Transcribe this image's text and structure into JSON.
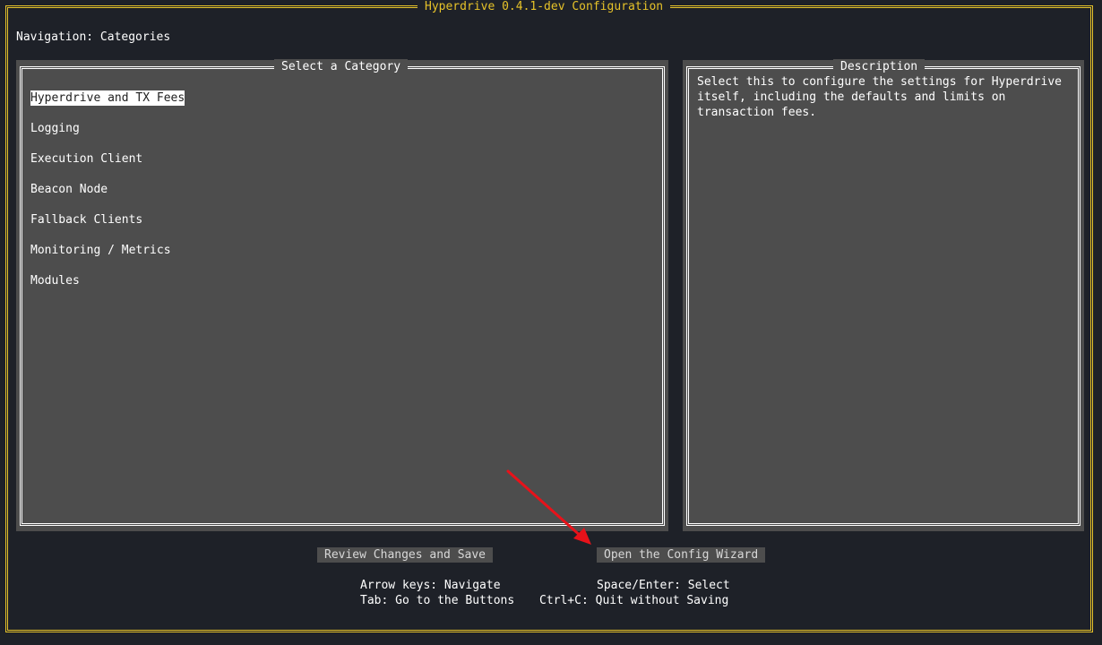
{
  "window": {
    "title": "Hyperdrive 0.4.1-dev Configuration"
  },
  "navigation": {
    "label": "Navigation: Categories"
  },
  "categories_panel": {
    "title": "Select a Category",
    "selected_index": 0,
    "items": [
      {
        "label": "Hyperdrive and TX Fees"
      },
      {
        "label": "Logging"
      },
      {
        "label": "Execution Client"
      },
      {
        "label": "Beacon Node"
      },
      {
        "label": "Fallback Clients"
      },
      {
        "label": "Monitoring / Metrics"
      },
      {
        "label": "Modules"
      }
    ]
  },
  "description_panel": {
    "title": "Description",
    "text": "Select this to configure the settings for Hyperdrive itself, including the defaults and limits on transaction fees."
  },
  "buttons": {
    "review": "Review Changes and Save",
    "wizard": "Open the Config Wizard"
  },
  "help": {
    "arrow_keys": "Arrow keys: Navigate",
    "space_enter": "Space/Enter: Select",
    "tab": "Tab: Go to the Buttons",
    "ctrl_c": "Ctrl+C: Quit without Saving"
  },
  "colors": {
    "background": "#1e2128",
    "frame": "#e6c229",
    "panel": "#4d4d4d",
    "annotation_arrow": "#e8121a"
  }
}
